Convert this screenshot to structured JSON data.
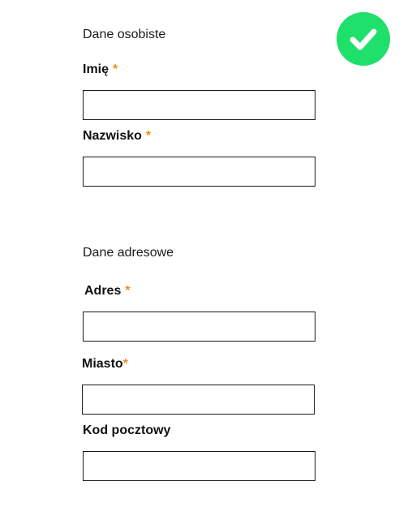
{
  "personal": {
    "heading": "Dane osobiste",
    "first_name": {
      "label": "Imię",
      "required_mark": "*",
      "value": ""
    },
    "last_name": {
      "label": "Nazwisko",
      "required_mark": "*",
      "value": ""
    }
  },
  "address": {
    "heading": "Dane adresowe",
    "street": {
      "label": "Adres",
      "required_mark": "*",
      "value": ""
    },
    "city": {
      "label": "Miasto",
      "required_mark": "*",
      "value": ""
    },
    "postal_code": {
      "label": "Kod pocztowy",
      "value": ""
    }
  },
  "status": {
    "icon": "check-icon",
    "color": "#1fe06a",
    "required_color": "#f08a1c"
  }
}
